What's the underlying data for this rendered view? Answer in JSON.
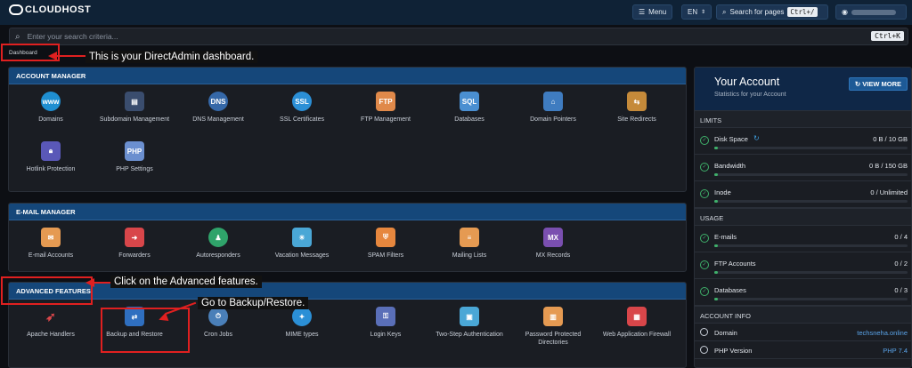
{
  "header": {
    "logo": "CLOUDHOST",
    "menu_label": "Menu",
    "lang": "EN",
    "search_pages_label": "Search for pages",
    "search_pages_kbd": "Ctrl+/"
  },
  "search": {
    "placeholder": "Enter your search criteria...",
    "kbd": "Ctrl+K"
  },
  "breadcrumb": "Dashboard",
  "annotations": {
    "dashboard": "This is your DirectAdmin dashboard.",
    "advanced": "Click on the Advanced features.",
    "backup": "Go to Backup/Restore."
  },
  "account_manager": {
    "title": "ACCOUNT MANAGER",
    "items": [
      "Domains",
      "Subdomain Management",
      "DNS Management",
      "SSL Certificates",
      "FTP Management",
      "Databases",
      "Domain Pointers",
      "Site Redirects",
      "Hotlink Protection",
      "PHP Settings"
    ]
  },
  "email_manager": {
    "title": "E-MAIL MANAGER",
    "items": [
      "E-mail Accounts",
      "Forwarders",
      "Autoresponders",
      "Vacation Messages",
      "SPAM Filters",
      "Mailing Lists",
      "MX Records"
    ]
  },
  "advanced_features": {
    "title": "ADVANCED FEATURES",
    "items": [
      "Apache Handlers",
      "Backup and Restore",
      "Cron Jobs",
      "MIME types",
      "Login Keys",
      "Two-Step Authentication",
      "Password Protected Directories",
      "Web Application Firewall"
    ]
  },
  "account": {
    "title": "Your Account",
    "subtitle": "Statistics for your Account",
    "view_more": "VIEW MORE",
    "limits_title": "LIMITS",
    "limits": [
      {
        "name": "Disk Space",
        "value": "0 B / 10 GB"
      },
      {
        "name": "Bandwidth",
        "value": "0 B / 150 GB"
      },
      {
        "name": "Inode",
        "value": "0 / Unlimited"
      }
    ],
    "usage_title": "USAGE",
    "usage": [
      {
        "name": "E-mails",
        "value": "0 / 4"
      },
      {
        "name": "FTP Accounts",
        "value": "0 / 2"
      },
      {
        "name": "Databases",
        "value": "0 / 3"
      }
    ],
    "info_title": "ACCOUNT INFO",
    "info": [
      {
        "name": "Domain",
        "value": "techsneha.online"
      },
      {
        "name": "PHP Version",
        "value": "PHP 7.4"
      }
    ]
  },
  "colors": {
    "accent": "#15477a",
    "annotation": "#e02020",
    "ok": "#3fb06a"
  }
}
